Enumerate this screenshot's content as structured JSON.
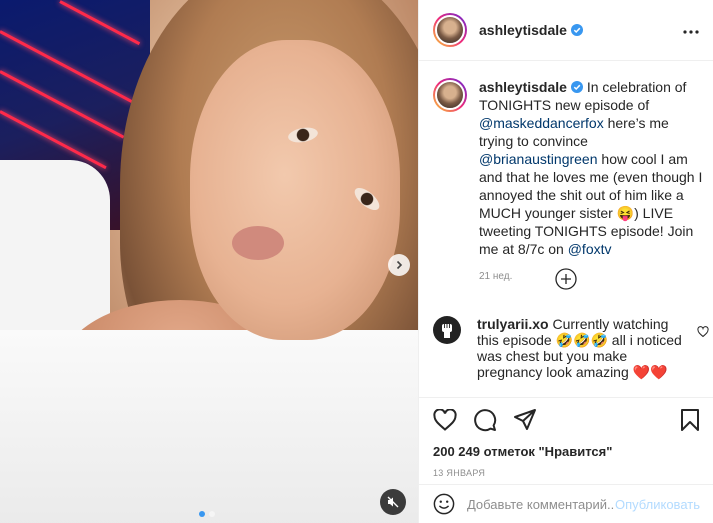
{
  "post": {
    "username": "ashleytisdale",
    "caption_parts": [
      {
        "type": "text",
        "value": "In celebration of TONIGHTS new episode of "
      },
      {
        "type": "mention",
        "value": "@maskeddancerfox"
      },
      {
        "type": "text",
        "value": " here’s me trying to convince "
      },
      {
        "type": "mention",
        "value": "@brianaustingreen"
      },
      {
        "type": "text",
        "value": " how cool I am and that he loves me (even though I annoyed the shit out of him like a MUCH younger sister 😝) LIVE tweeting TONIGHTS episode! Join me at 8/7c on "
      },
      {
        "type": "mention",
        "value": "@foxtv"
      }
    ],
    "caption_age": "21 нед.",
    "likes": "200 249 отметок \"Нравится\"",
    "date": "13 ЯНВАРЯ"
  },
  "comment": {
    "username": "trulyarii.xo",
    "text": "Currently watching this episode 🤣🤣🤣 all i noticed was chest but you make pregnancy look amazing ❤️❤️"
  },
  "add_comment": {
    "placeholder": "Добавьте комментарий...",
    "post_label": "Опубликовать"
  },
  "carousel": {
    "current": 1,
    "total": 2
  },
  "icons": [
    "more-icon",
    "verified-icon",
    "load-more-icon",
    "heart-icon",
    "comment-icon",
    "share-icon",
    "bookmark-icon",
    "emoji-icon",
    "next-arrow-icon",
    "mute-icon",
    "comment-like-icon"
  ],
  "colors": {
    "link": "#00376b",
    "verified": "#3897f0",
    "muted": "#8e8e8e",
    "post_disabled": "#b3dbff"
  }
}
